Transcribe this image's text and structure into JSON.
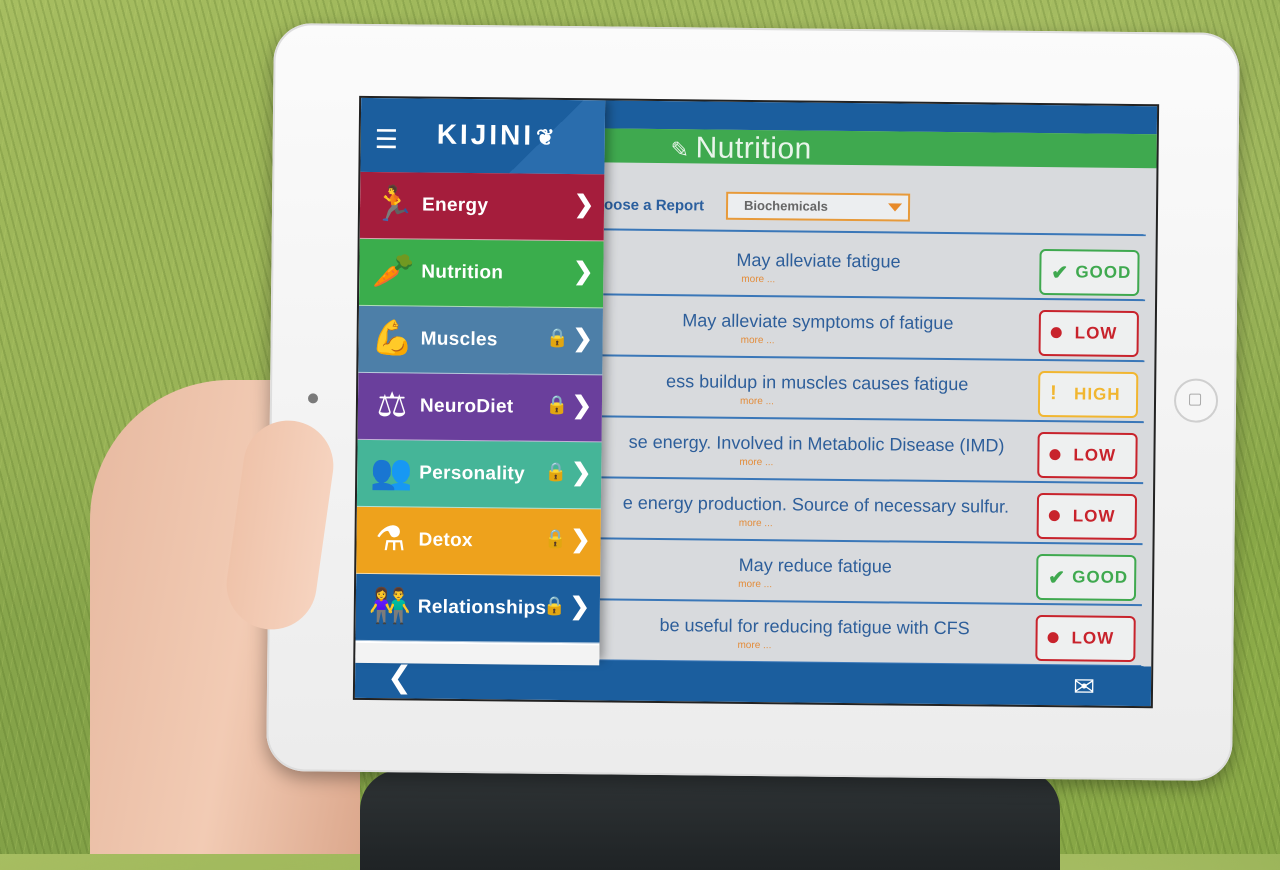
{
  "app": {
    "name": "KIJINI",
    "logo_glyph": "❦",
    "menu_icon": "☰"
  },
  "page": {
    "title": "Nutrition",
    "title_icon": "✎"
  },
  "report": {
    "label": "oose a Report",
    "selected": "Biochemicals"
  },
  "rows": [
    {
      "text": "May alleviate fatigue",
      "more": "more ...",
      "status": "GOOD",
      "kind": "good",
      "mark": "✔"
    },
    {
      "text": "May alleviate symptoms of fatigue",
      "more": "more ...",
      "status": "LOW",
      "kind": "low",
      "mark": "●"
    },
    {
      "text": "ess buildup in muscles causes fatigue",
      "more": "more ...",
      "status": "HIGH",
      "kind": "high",
      "mark": "!"
    },
    {
      "text": "se energy. Involved in Metabolic Disease (IMD)",
      "more": "more ...",
      "status": "LOW",
      "kind": "low",
      "mark": "●"
    },
    {
      "text": "e energy production. Source of necessary sulfur.",
      "more": "more ...",
      "status": "LOW",
      "kind": "low",
      "mark": "●"
    },
    {
      "text": "May reduce fatigue",
      "more": "more ...",
      "status": "GOOD",
      "kind": "good",
      "mark": "✔"
    },
    {
      "text": "be useful for reducing fatigue with CFS",
      "more": "more ...",
      "status": "LOW",
      "kind": "low",
      "mark": "●"
    }
  ],
  "menu": [
    {
      "label": "Energy",
      "icon": "🏃",
      "locked": false,
      "color": "#a51d3c"
    },
    {
      "label": "Nutrition",
      "icon": "🥕",
      "locked": false,
      "color": "#3aad4c"
    },
    {
      "label": "Muscles",
      "icon": "💪",
      "locked": true,
      "color": "#4d7fa8"
    },
    {
      "label": "NeuroDiet",
      "icon": "⚖",
      "locked": true,
      "color": "#6a3f9c"
    },
    {
      "label": "Personality",
      "icon": "👥",
      "locked": true,
      "color": "#45b598"
    },
    {
      "label": "Detox",
      "icon": "⚗",
      "locked": true,
      "color": "#eea21c"
    },
    {
      "label": "Relationships",
      "icon": "👫",
      "locked": true,
      "color": "#1b5e9e"
    }
  ],
  "icons": {
    "lock": "🔒",
    "chevron": "❯",
    "back": "❮",
    "mail": "✉"
  }
}
